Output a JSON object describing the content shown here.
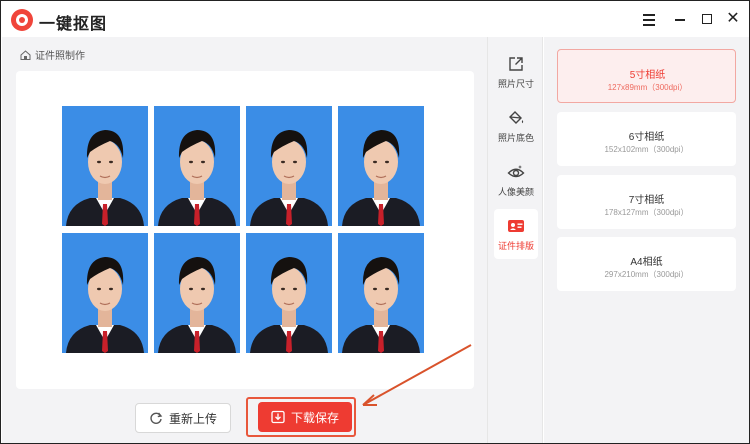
{
  "app": {
    "title": "一键抠图"
  },
  "breadcrumb": {
    "label": "证件照制作"
  },
  "photos": {
    "count": 8,
    "background_color": "#3b8de6"
  },
  "buttons": {
    "reupload": "重新上传",
    "download": "下载保存"
  },
  "toolbar": [
    {
      "label": "照片尺寸",
      "icon": "export-icon"
    },
    {
      "label": "照片底色",
      "icon": "paint-bucket-icon"
    },
    {
      "label": "人像美颜",
      "icon": "eye-icon"
    },
    {
      "label": "证件排版",
      "icon": "id-card-icon"
    }
  ],
  "sizes": [
    {
      "name": "5寸相纸",
      "dim": "127x89mm（300dpi）"
    },
    {
      "name": "6寸相纸",
      "dim": "152x102mm（300dpi）"
    },
    {
      "name": "7寸相纸",
      "dim": "178x127mm（300dpi）"
    },
    {
      "name": "A4相纸",
      "dim": "297x210mm（300dpi）"
    }
  ],
  "colors": {
    "accent": "#ee3b32",
    "photo_bg": "#3b8de6",
    "panel_bg": "#f3f3f5"
  }
}
